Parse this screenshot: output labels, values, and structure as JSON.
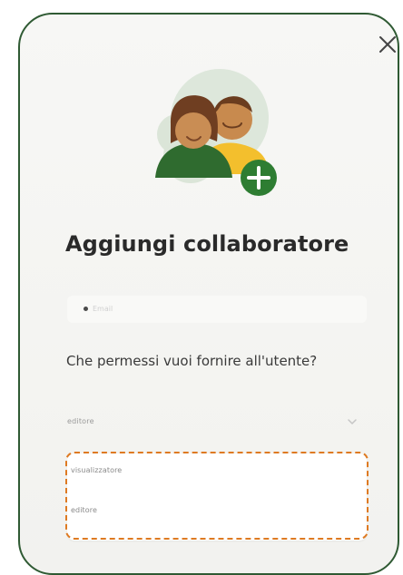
{
  "dialog": {
    "title": "Aggiungi collaboratore",
    "email_placeholder": "Email",
    "question": "Che permessi vuoi fornire all'utente?",
    "permission_select": {
      "selected": "editore",
      "options": [
        "visualizzatore",
        "editore"
      ]
    }
  },
  "icons": {
    "close": "close-icon",
    "email": "email-icon",
    "chevron": "chevron-down-icon",
    "illustration": "add-collaborator-illustration"
  },
  "colors": {
    "frame_border": "#2f5a33",
    "highlight_border": "#de7a22",
    "add_badge": "#2e7d32",
    "background": "#f4f4f1"
  }
}
